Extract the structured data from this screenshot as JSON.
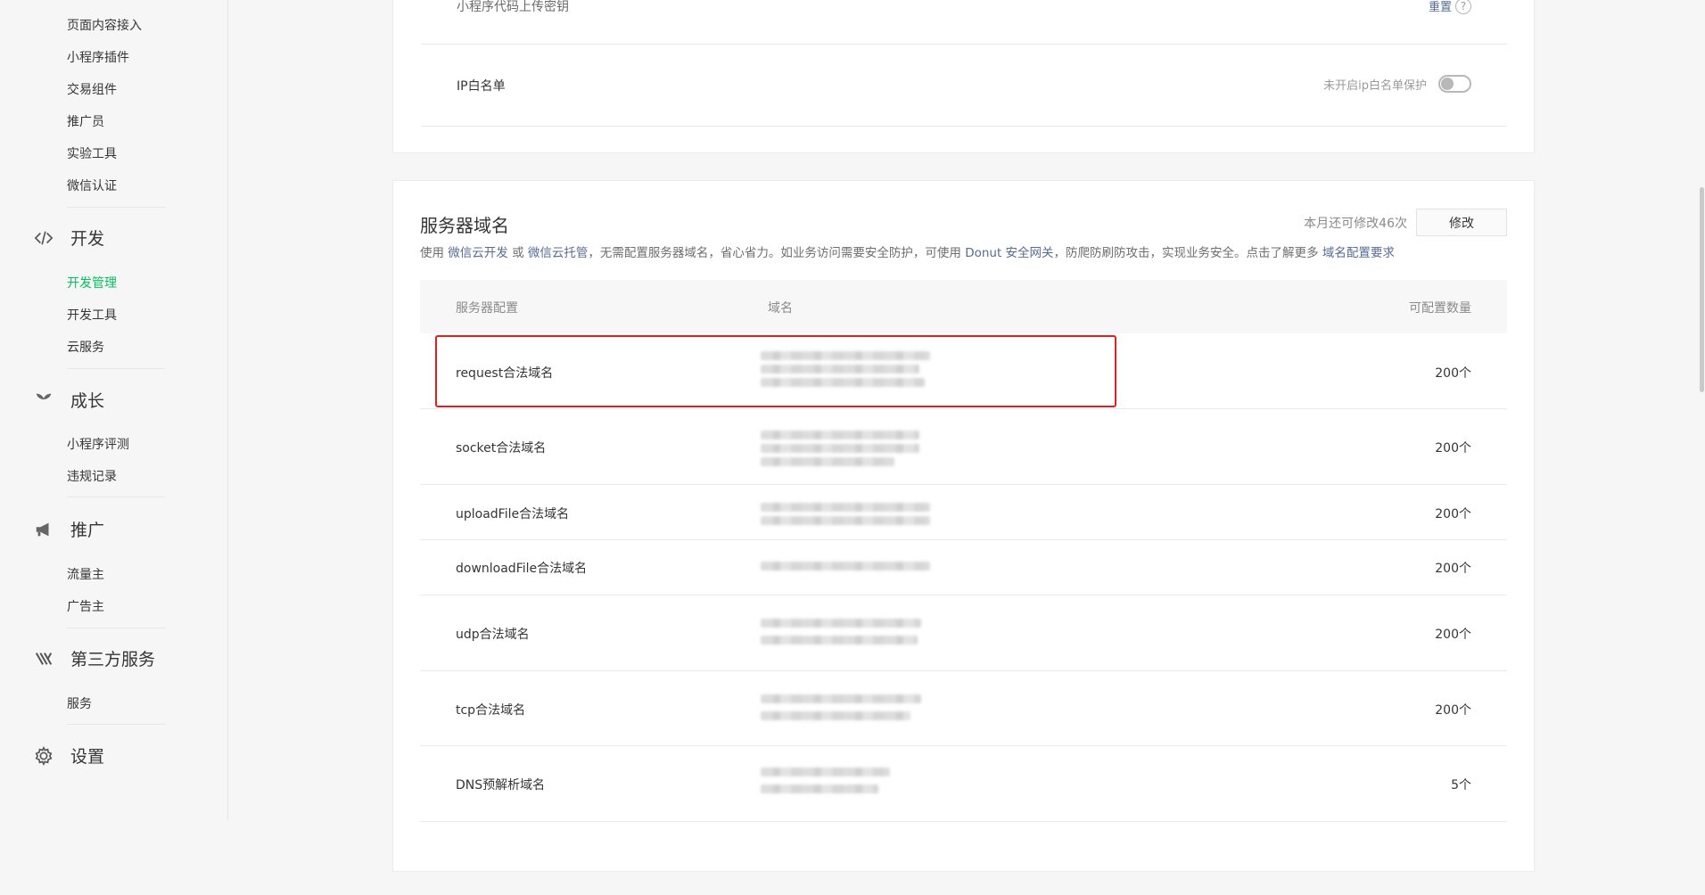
{
  "sidebar": {
    "items": [
      {
        "label": "页面内容接入"
      },
      {
        "label": "小程序插件"
      },
      {
        "label": "交易组件"
      },
      {
        "label": "推广员"
      },
      {
        "label": "实验工具"
      },
      {
        "label": "微信认证"
      }
    ],
    "groups": [
      {
        "label": "开发",
        "icon": "code-icon",
        "items": [
          {
            "label": "开发管理",
            "active": true
          },
          {
            "label": "开发工具"
          },
          {
            "label": "云服务"
          }
        ]
      },
      {
        "label": "成长",
        "icon": "sprout-icon",
        "items": [
          {
            "label": "小程序评测"
          },
          {
            "label": "违规记录"
          }
        ]
      },
      {
        "label": "推广",
        "icon": "megaphone-icon",
        "items": [
          {
            "label": "流量主"
          },
          {
            "label": "广告主"
          }
        ]
      },
      {
        "label": "第三方服务",
        "icon": "third-party-icon",
        "items": [
          {
            "label": "服务"
          }
        ]
      },
      {
        "label": "设置",
        "icon": "gear-icon",
        "items": []
      }
    ]
  },
  "top_card": {
    "upload_key_label": "小程序代码上传密钥",
    "upload_key_action": "重置",
    "ip_whitelist_label": "IP白名单",
    "ip_whitelist_status": "未开启ip白名单保护"
  },
  "server_domain": {
    "title": "服务器域名",
    "quota": "本月还可修改46次",
    "modify_label": "修改",
    "desc": {
      "prefix": "使用",
      "link1": "微信云开发",
      "or": "或",
      "link2": "微信云托管",
      "mid": "，无需配置服务器域名，省心省力。如业务访问需要安全防护，可使用",
      "link3": "Donut 安全网关",
      "mid2": "，防爬防刷防攻击，实现业务安全。点击了解更多",
      "link4": "域名配置要求"
    },
    "columns": [
      "服务器配置",
      "域名",
      "可配置数量"
    ],
    "rows": [
      {
        "name": "request合法域名",
        "count": "200个"
      },
      {
        "name": "socket合法域名",
        "count": "200个"
      },
      {
        "name": "uploadFile合法域名",
        "count": "200个"
      },
      {
        "name": "downloadFile合法域名",
        "count": "200个"
      },
      {
        "name": "udp合法域名",
        "count": "200个"
      },
      {
        "name": "tcp合法域名",
        "count": "200个"
      },
      {
        "name": "DNS预解析域名",
        "count": "5个"
      }
    ]
  },
  "colors": {
    "accent": "#07c160",
    "link": "#576b95",
    "highlight": "#e02020"
  }
}
